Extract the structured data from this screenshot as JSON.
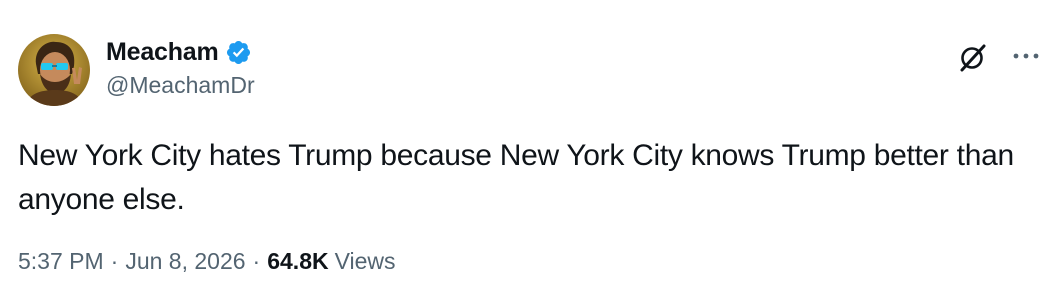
{
  "author": {
    "display_name": "Meacham",
    "handle": "@MeachamDr",
    "verified": true,
    "avatar_icon": "profile-avatar"
  },
  "actions": {
    "grok_icon": "grok-icon",
    "more_icon": "more-icon"
  },
  "tweet": {
    "text": "New York City hates Trump because New York City knows Trump better than anyone else."
  },
  "meta": {
    "time": "5:37 PM",
    "separator": "·",
    "date": "Jun 8, 2026",
    "views_count": "64.8K",
    "views_label": "Views"
  },
  "colors": {
    "text_primary": "#0f1419",
    "text_secondary": "#536471",
    "verified_blue": "#1d9bf0",
    "background": "#ffffff"
  }
}
